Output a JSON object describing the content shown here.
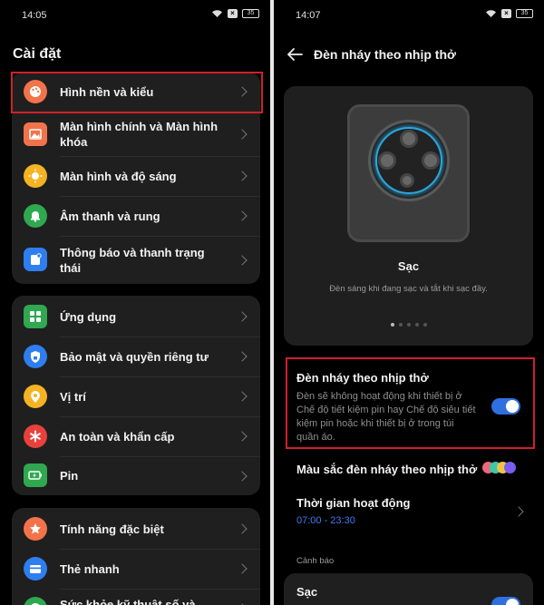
{
  "left": {
    "status_time": "14:05",
    "battery": "35",
    "title": "Cài đặt",
    "groups": [
      {
        "items": [
          {
            "label": "Hình nền và kiểu",
            "icon": "palette-icon",
            "color": "#f2734a"
          },
          {
            "label": "Màn hình chính và Màn hình khóa",
            "icon": "picture-icon",
            "color": "#f2734a"
          },
          {
            "label": "Màn hình và độ sáng",
            "icon": "sun-icon",
            "color": "#f5b323"
          },
          {
            "label": "Âm thanh và rung",
            "icon": "bell-icon",
            "color": "#2fa84f"
          },
          {
            "label": "Thông báo và thanh trạng thái",
            "icon": "notification-icon",
            "color": "#2f7ef0"
          }
        ]
      },
      {
        "items": [
          {
            "label": "Ứng dụng",
            "icon": "apps-icon",
            "color": "#2fa84f"
          },
          {
            "label": "Bảo mật và quyền riêng tư",
            "icon": "shield-lock-icon",
            "color": "#2f7ef0"
          },
          {
            "label": "Vị trí",
            "icon": "location-pin-icon",
            "color": "#f5b323"
          },
          {
            "label": "An toàn và khẩn cấp",
            "icon": "asterisk-icon",
            "color": "#e8413c"
          },
          {
            "label": "Pin",
            "icon": "battery-icon",
            "color": "#2fa84f"
          }
        ]
      },
      {
        "items": [
          {
            "label": "Tính năng đặc biệt",
            "icon": "star-icon",
            "color": "#f2734a"
          },
          {
            "label": "Thẻ nhanh",
            "icon": "card-icon",
            "color": "#2f7ef0"
          },
          {
            "label": "Sức khỏe kỹ thuật số và",
            "icon": "health-icon",
            "color": "#2fa84f"
          }
        ]
      }
    ]
  },
  "right": {
    "status_time": "14:07",
    "battery": "35",
    "title": "Đèn nháy theo nhịp thở",
    "card": {
      "title": "Sạc",
      "desc": "Đèn sáng khi đang sạc và tắt khi sạc đầy."
    },
    "option": {
      "title": "Đèn nháy theo nhịp thở",
      "desc": "Đèn sẽ không hoạt động khi thiết bị ở Chế độ tiết kiệm pin hay Chế độ siêu tiết kiệm pin hoặc khi thiết bị ở trong túi quần áo.",
      "enabled": true
    },
    "color_option": {
      "label": "Màu sắc đèn nháy theo nhịp thở",
      "swatches": [
        "#e96a7a",
        "#3ec7a8",
        "#f1c24a",
        "#7b5cf0"
      ]
    },
    "time_option": {
      "label": "Thời gian hoạt động",
      "value": "07:00 - 23:30"
    },
    "section": "Cảnh báo",
    "bottom_item": "Sạc"
  }
}
